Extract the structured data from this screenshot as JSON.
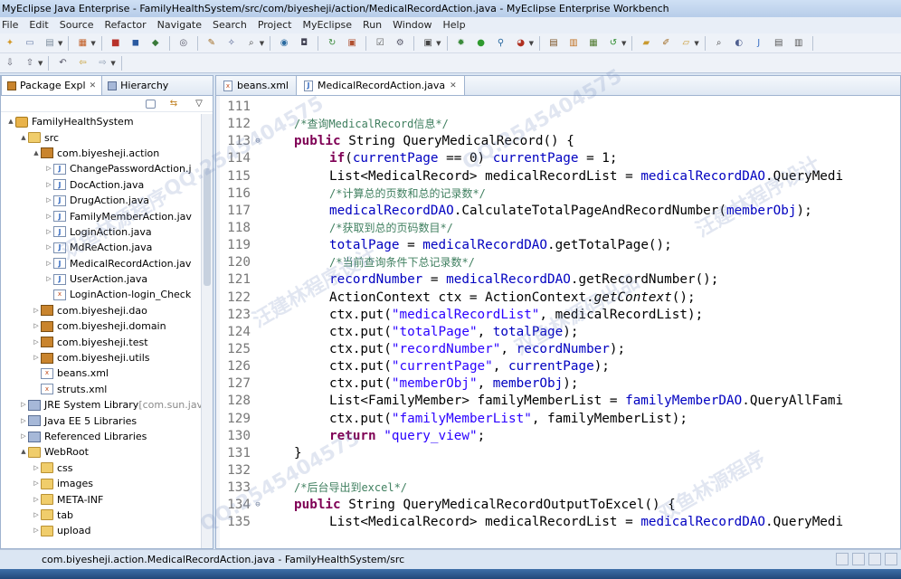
{
  "window": {
    "title": "MyEclipse Java Enterprise - FamilyHealthSystem/src/com/biyesheji/action/MedicalRecordAction.java - MyEclipse Enterprise Workbench"
  },
  "menu": [
    "File",
    "Edit",
    "Source",
    "Refactor",
    "Navigate",
    "Search",
    "Project",
    "MyEclipse",
    "Run",
    "Window",
    "Help"
  ],
  "left_panel": {
    "tabs": [
      {
        "label": "Package Expl",
        "close": "✕"
      },
      {
        "label": "Hierarchy",
        "close": ""
      }
    ],
    "tree": [
      {
        "level": 0,
        "twisty": "▲",
        "icon": "project",
        "label": "FamilyHealthSystem",
        "suffix": ""
      },
      {
        "level": 1,
        "twisty": "▲",
        "icon": "folder",
        "label": "src",
        "suffix": ""
      },
      {
        "level": 2,
        "twisty": "▲",
        "icon": "package",
        "label": "com.biyesheji.action",
        "suffix": ""
      },
      {
        "level": 3,
        "twisty": "▷",
        "icon": "java",
        "label": "ChangePasswordAction.j",
        "suffix": ""
      },
      {
        "level": 3,
        "twisty": "▷",
        "icon": "java",
        "label": "DocAction.java",
        "suffix": ""
      },
      {
        "level": 3,
        "twisty": "▷",
        "icon": "java",
        "label": "DrugAction.java",
        "suffix": ""
      },
      {
        "level": 3,
        "twisty": "▷",
        "icon": "java",
        "label": "FamilyMemberAction.jav",
        "suffix": ""
      },
      {
        "level": 3,
        "twisty": "▷",
        "icon": "java",
        "label": "LoginAction.java",
        "suffix": ""
      },
      {
        "level": 3,
        "twisty": "▷",
        "icon": "java",
        "label": "MdReAction.java",
        "suffix": ""
      },
      {
        "level": 3,
        "twisty": "▷",
        "icon": "java",
        "label": "MedicalRecordAction.jav",
        "suffix": ""
      },
      {
        "level": 3,
        "twisty": "▷",
        "icon": "java",
        "label": "UserAction.java",
        "suffix": ""
      },
      {
        "level": 3,
        "twisty": "",
        "icon": "xml",
        "label": "LoginAction-login_Check",
        "suffix": ""
      },
      {
        "level": 2,
        "twisty": "▷",
        "icon": "package",
        "label": "com.biyesheji.dao",
        "suffix": ""
      },
      {
        "level": 2,
        "twisty": "▷",
        "icon": "package",
        "label": "com.biyesheji.domain",
        "suffix": ""
      },
      {
        "level": 2,
        "twisty": "▷",
        "icon": "package",
        "label": "com.biyesheji.test",
        "suffix": ""
      },
      {
        "level": 2,
        "twisty": "▷",
        "icon": "package",
        "label": "com.biyesheji.utils",
        "suffix": ""
      },
      {
        "level": 2,
        "twisty": "",
        "icon": "xml",
        "label": "beans.xml",
        "suffix": ""
      },
      {
        "level": 2,
        "twisty": "",
        "icon": "xml",
        "label": "struts.xml",
        "suffix": ""
      },
      {
        "level": 1,
        "twisty": "▷",
        "icon": "library",
        "label": "JRE System Library ",
        "suffix": "[com.sun.jav"
      },
      {
        "level": 1,
        "twisty": "▷",
        "icon": "library",
        "label": "Java EE 5 Libraries",
        "suffix": ""
      },
      {
        "level": 1,
        "twisty": "▷",
        "icon": "library",
        "label": "Referenced Libraries",
        "suffix": ""
      },
      {
        "level": 1,
        "twisty": "▲",
        "icon": "folder",
        "label": "WebRoot",
        "suffix": ""
      },
      {
        "level": 2,
        "twisty": "▷",
        "icon": "folder",
        "label": "css",
        "suffix": ""
      },
      {
        "level": 2,
        "twisty": "▷",
        "icon": "folder",
        "label": "images",
        "suffix": ""
      },
      {
        "level": 2,
        "twisty": "▷",
        "icon": "folder",
        "label": "META-INF",
        "suffix": ""
      },
      {
        "level": 2,
        "twisty": "▷",
        "icon": "folder",
        "label": "tab",
        "suffix": ""
      },
      {
        "level": 2,
        "twisty": "▷",
        "icon": "folder",
        "label": "upload",
        "suffix": ""
      }
    ]
  },
  "editor": {
    "tabs": [
      {
        "label": "beans.xml",
        "active": false,
        "close": ""
      },
      {
        "label": "MedicalRecordAction.java",
        "active": true,
        "close": "✕"
      }
    ],
    "lines": [
      {
        "n": "111",
        "fold": "",
        "indent": 0,
        "segs": []
      },
      {
        "n": "112",
        "fold": "",
        "indent": 1,
        "segs": [
          {
            "t": "/*查询MedicalRecord信息*/",
            "c": "cmt"
          }
        ]
      },
      {
        "n": "113",
        "fold": "⊖",
        "indent": 1,
        "segs": [
          {
            "t": "public",
            "c": "kw"
          },
          {
            "t": " String QueryMedicalRecord() {",
            "c": ""
          }
        ]
      },
      {
        "n": "114",
        "fold": "",
        "indent": 2,
        "segs": [
          {
            "t": "if",
            "c": "kw"
          },
          {
            "t": "(",
            "c": ""
          },
          {
            "t": "currentPage",
            "c": "fld"
          },
          {
            "t": " == 0) ",
            "c": ""
          },
          {
            "t": "currentPage",
            "c": "fld"
          },
          {
            "t": " = 1;",
            "c": ""
          }
        ]
      },
      {
        "n": "115",
        "fold": "",
        "indent": 2,
        "segs": [
          {
            "t": "List<MedicalRecord> medicalRecordList = ",
            "c": ""
          },
          {
            "t": "medicalRecordDAO",
            "c": "fld"
          },
          {
            "t": ".QueryMedi",
            "c": ""
          }
        ]
      },
      {
        "n": "116",
        "fold": "",
        "indent": 2,
        "segs": [
          {
            "t": "/*计算总的页数和总的记录数*/",
            "c": "cmt"
          }
        ]
      },
      {
        "n": "117",
        "fold": "",
        "indent": 2,
        "segs": [
          {
            "t": "medicalRecordDAO",
            "c": "fld"
          },
          {
            "t": ".CalculateTotalPageAndRecordNumber(",
            "c": ""
          },
          {
            "t": "memberObj",
            "c": "fld"
          },
          {
            "t": ");",
            "c": ""
          }
        ]
      },
      {
        "n": "118",
        "fold": "",
        "indent": 2,
        "segs": [
          {
            "t": "/*获取到总的页码数目*/",
            "c": "cmt"
          }
        ]
      },
      {
        "n": "119",
        "fold": "",
        "indent": 2,
        "segs": [
          {
            "t": "totalPage",
            "c": "fld"
          },
          {
            "t": " = ",
            "c": ""
          },
          {
            "t": "medicalRecordDAO",
            "c": "fld"
          },
          {
            "t": ".getTotalPage();",
            "c": ""
          }
        ]
      },
      {
        "n": "120",
        "fold": "",
        "indent": 2,
        "segs": [
          {
            "t": "/*当前查询条件下总记录数*/",
            "c": "cmt"
          }
        ]
      },
      {
        "n": "121",
        "fold": "",
        "indent": 2,
        "segs": [
          {
            "t": "recordNumber",
            "c": "fld"
          },
          {
            "t": " = ",
            "c": ""
          },
          {
            "t": "medicalRecordDAO",
            "c": "fld"
          },
          {
            "t": ".getRecordNumber();",
            "c": ""
          }
        ]
      },
      {
        "n": "122",
        "fold": "",
        "indent": 2,
        "segs": [
          {
            "t": "ActionContext ctx = ActionContext.",
            "c": ""
          },
          {
            "t": "getContext",
            "c": "ital"
          },
          {
            "t": "();",
            "c": ""
          }
        ]
      },
      {
        "n": "123",
        "fold": "",
        "indent": 2,
        "segs": [
          {
            "t": "ctx.put(",
            "c": ""
          },
          {
            "t": "\"medicalRecordList\"",
            "c": "str"
          },
          {
            "t": ", medicalRecordList);",
            "c": ""
          }
        ]
      },
      {
        "n": "124",
        "fold": "",
        "indent": 2,
        "segs": [
          {
            "t": "ctx.put(",
            "c": ""
          },
          {
            "t": "\"totalPage\"",
            "c": "str"
          },
          {
            "t": ", ",
            "c": ""
          },
          {
            "t": "totalPage",
            "c": "fld"
          },
          {
            "t": ");",
            "c": ""
          }
        ]
      },
      {
        "n": "125",
        "fold": "",
        "indent": 2,
        "segs": [
          {
            "t": "ctx.put(",
            "c": ""
          },
          {
            "t": "\"recordNumber\"",
            "c": "str"
          },
          {
            "t": ", ",
            "c": ""
          },
          {
            "t": "recordNumber",
            "c": "fld"
          },
          {
            "t": ");",
            "c": ""
          }
        ]
      },
      {
        "n": "126",
        "fold": "",
        "indent": 2,
        "segs": [
          {
            "t": "ctx.put(",
            "c": ""
          },
          {
            "t": "\"currentPage\"",
            "c": "str"
          },
          {
            "t": ", ",
            "c": ""
          },
          {
            "t": "currentPage",
            "c": "fld"
          },
          {
            "t": ");",
            "c": ""
          }
        ]
      },
      {
        "n": "127",
        "fold": "",
        "indent": 2,
        "segs": [
          {
            "t": "ctx.put(",
            "c": ""
          },
          {
            "t": "\"memberObj\"",
            "c": "str"
          },
          {
            "t": ", ",
            "c": ""
          },
          {
            "t": "memberObj",
            "c": "fld"
          },
          {
            "t": ");",
            "c": ""
          }
        ]
      },
      {
        "n": "128",
        "fold": "",
        "indent": 2,
        "segs": [
          {
            "t": "List<FamilyMember> familyMemberList = ",
            "c": ""
          },
          {
            "t": "familyMemberDAO",
            "c": "fld"
          },
          {
            "t": ".QueryAllFami",
            "c": ""
          }
        ]
      },
      {
        "n": "129",
        "fold": "",
        "indent": 2,
        "segs": [
          {
            "t": "ctx.put(",
            "c": ""
          },
          {
            "t": "\"familyMemberList\"",
            "c": "str"
          },
          {
            "t": ", familyMemberList);",
            "c": ""
          }
        ]
      },
      {
        "n": "130",
        "fold": "",
        "indent": 2,
        "segs": [
          {
            "t": "return",
            "c": "kw"
          },
          {
            "t": " ",
            "c": ""
          },
          {
            "t": "\"query_view\"",
            "c": "str"
          },
          {
            "t": ";",
            "c": ""
          }
        ]
      },
      {
        "n": "131",
        "fold": "",
        "indent": 1,
        "segs": [
          {
            "t": "}",
            "c": ""
          }
        ]
      },
      {
        "n": "132",
        "fold": "",
        "indent": 0,
        "segs": []
      },
      {
        "n": "133",
        "fold": "",
        "indent": 1,
        "segs": [
          {
            "t": "/*后台导出到excel*/",
            "c": "cmt"
          }
        ]
      },
      {
        "n": "134",
        "fold": "⊖",
        "indent": 1,
        "segs": [
          {
            "t": "public",
            "c": "kw"
          },
          {
            "t": " String QueryMedicalRecordOutputToExcel() {",
            "c": ""
          }
        ]
      },
      {
        "n": "135",
        "fold": "",
        "indent": 2,
        "segs": [
          {
            "t": "List<MedicalRecord> medicalRecordList = ",
            "c": ""
          },
          {
            "t": "medicalRecordDAO",
            "c": "fld"
          },
          {
            "t": ".QueryMedi",
            "c": ""
          }
        ]
      }
    ]
  },
  "status": {
    "text": "com.biyesheji.action.MedicalRecordAction.java - FamilyHealthSystem/src"
  },
  "watermarks": [
    "QQ:2545404575",
    "双鱼林源程序",
    "汪建林程序设计",
    "QQ:2545404575",
    "双鱼林源码出品",
    "汪建林程序设计",
    "QQ:2545404575",
    "双鱼林源程序"
  ]
}
